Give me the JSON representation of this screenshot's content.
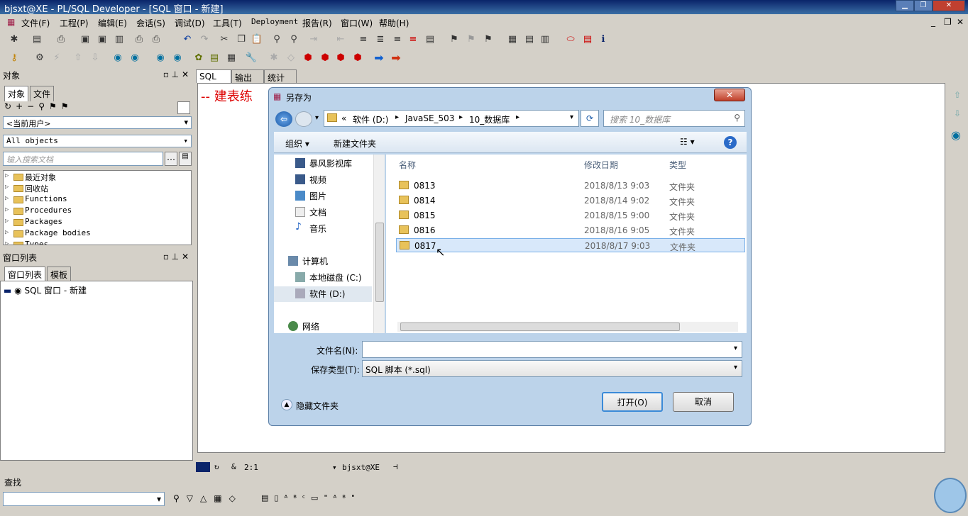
{
  "window": {
    "title": "bjsxt@XE - PL/SQL Developer - [SQL 窗口 - 新建]"
  },
  "menu": [
    "文件(F)",
    "工程(P)",
    "编辑(E)",
    "会话(S)",
    "调试(D)",
    "工具(T)",
    "Deployment",
    "报告(R)",
    "窗口(W)",
    "帮助(H)"
  ],
  "objects_panel": {
    "title": "对象",
    "tabs": [
      "对象",
      "文件"
    ],
    "user_select": "<当前用户>",
    "filter_select": "All objects",
    "search_placeholder": "输入搜索文档",
    "tree": [
      "最近对象",
      "回收站",
      "Functions",
      "Procedures",
      "Packages",
      "Package bodies",
      "Types"
    ]
  },
  "window_list": {
    "title": "窗口列表",
    "tabs": [
      "窗口列表",
      "模板"
    ],
    "item": "SQL 窗口 - 新建"
  },
  "editor": {
    "tabs": [
      "SQL",
      "输出",
      "统计"
    ],
    "code": "--  建表练"
  },
  "dialog": {
    "title": "另存为",
    "close": "✕",
    "breadcrumb": [
      "«",
      "软件 (D:)",
      "JavaSE_503",
      "10_数据库"
    ],
    "search_placeholder": "搜索 10_数据库",
    "organize": "组织 ▾",
    "new_folder": "新建文件夹",
    "nav": [
      {
        "label": "暴风影视库",
        "icon": "video-library-icon"
      },
      {
        "label": "视频",
        "icon": "video-icon"
      },
      {
        "label": "图片",
        "icon": "picture-icon"
      },
      {
        "label": "文档",
        "icon": "document-icon"
      },
      {
        "label": "音乐",
        "icon": "music-icon"
      }
    ],
    "nav_computer": "计算机",
    "nav_drives": [
      "本地磁盘 (C:)",
      "软件 (D:)"
    ],
    "nav_network": "网络",
    "columns": [
      "名称",
      "修改日期",
      "类型"
    ],
    "files": [
      {
        "name": "0813",
        "date": "2018/8/13 9:03",
        "type": "文件夹"
      },
      {
        "name": "0814",
        "date": "2018/8/14 9:02",
        "type": "文件夹"
      },
      {
        "name": "0815",
        "date": "2018/8/15 9:00",
        "type": "文件夹"
      },
      {
        "name": "0816",
        "date": "2018/8/16 9:05",
        "type": "文件夹"
      },
      {
        "name": "0817",
        "date": "2018/8/17 9:03",
        "type": "文件夹"
      }
    ],
    "filename_label": "文件名(N):",
    "filename_value": "",
    "filetype_label": "保存类型(T):",
    "filetype_value": "SQL 脚本 (*.sql)",
    "hide_folders": "隐藏文件夹",
    "open_button": "打开(O)",
    "cancel_button": "取消"
  },
  "status": {
    "position": "2:1",
    "connection": "bjsxt@XE"
  },
  "findbar": {
    "title": "查找"
  }
}
